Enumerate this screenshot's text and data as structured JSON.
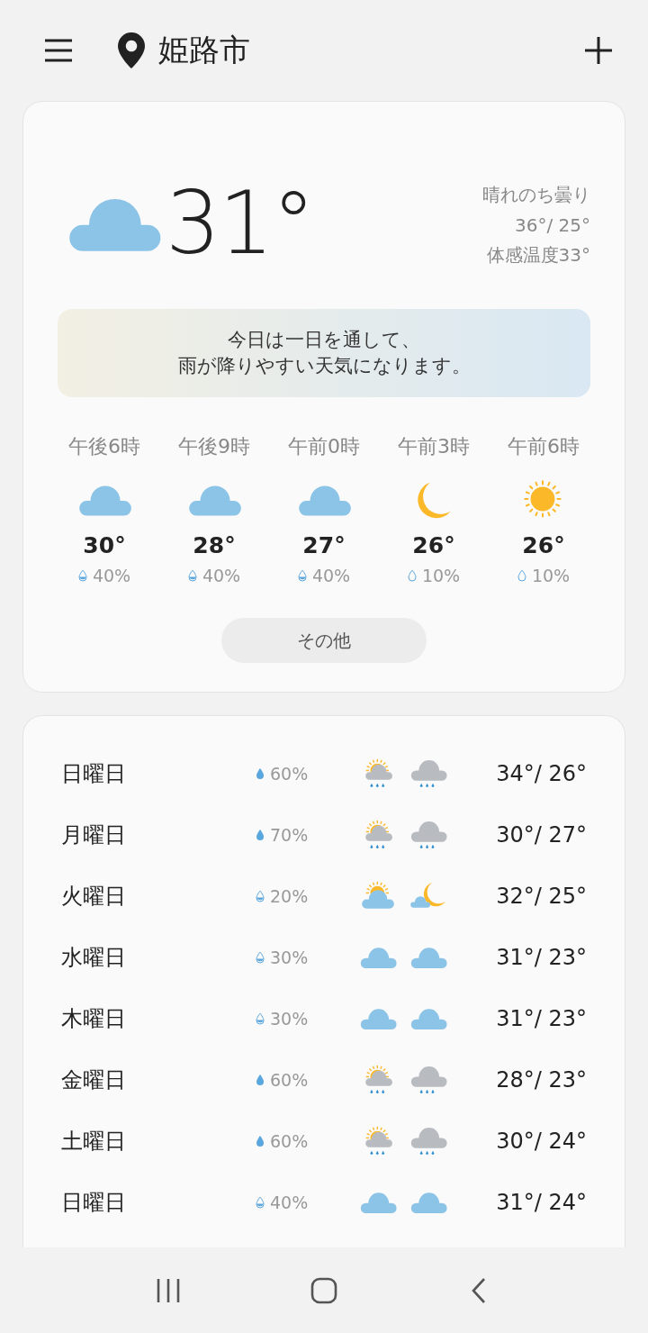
{
  "header": {
    "city": "姫路市"
  },
  "current": {
    "icon": {
      "kind": "cloud"
    },
    "temperature": "31°",
    "condition": "晴れのち曇り",
    "high_low": "36°/ 25°",
    "feels_like": "体感温度33°"
  },
  "summary": [
    "今日は一日を通して、",
    "雨が降りやすい天気になります。"
  ],
  "hourly": [
    {
      "time": "午後6時",
      "icon": {
        "kind": "cloud"
      },
      "temperature": "30°",
      "drop": {
        "kind": "half"
      },
      "precipitation": "40%"
    },
    {
      "time": "午後9時",
      "icon": {
        "kind": "cloud"
      },
      "temperature": "28°",
      "drop": {
        "kind": "half"
      },
      "precipitation": "40%"
    },
    {
      "time": "午前0時",
      "icon": {
        "kind": "cloud"
      },
      "temperature": "27°",
      "drop": {
        "kind": "half"
      },
      "precipitation": "40%"
    },
    {
      "time": "午前3時",
      "icon": {
        "kind": "moon"
      },
      "temperature": "26°",
      "drop": {
        "kind": "empty"
      },
      "precipitation": "10%"
    },
    {
      "time": "午前6時",
      "icon": {
        "kind": "sun"
      },
      "temperature": "26°",
      "drop": {
        "kind": "empty"
      },
      "precipitation": "10%"
    }
  ],
  "more_button": "その他",
  "daily": [
    {
      "day": "日曜日",
      "drop": {
        "kind": "full"
      },
      "precipitation": "60%",
      "day_icon": {
        "kind": "sun-rain"
      },
      "night_icon": {
        "kind": "rain"
      },
      "temperature": "34°/ 26°"
    },
    {
      "day": "月曜日",
      "drop": {
        "kind": "full"
      },
      "precipitation": "70%",
      "day_icon": {
        "kind": "sun-rain"
      },
      "night_icon": {
        "kind": "rain"
      },
      "temperature": "30°/ 27°"
    },
    {
      "day": "火曜日",
      "drop": {
        "kind": "half"
      },
      "precipitation": "20%",
      "day_icon": {
        "kind": "sun-cloud"
      },
      "night_icon": {
        "kind": "moon-cloud"
      },
      "temperature": "32°/ 25°"
    },
    {
      "day": "水曜日",
      "drop": {
        "kind": "half"
      },
      "precipitation": "30%",
      "day_icon": {
        "kind": "cloud"
      },
      "night_icon": {
        "kind": "cloud"
      },
      "temperature": "31°/ 23°"
    },
    {
      "day": "木曜日",
      "drop": {
        "kind": "half"
      },
      "precipitation": "30%",
      "day_icon": {
        "kind": "cloud"
      },
      "night_icon": {
        "kind": "cloud"
      },
      "temperature": "31°/ 23°"
    },
    {
      "day": "金曜日",
      "drop": {
        "kind": "full"
      },
      "precipitation": "60%",
      "day_icon": {
        "kind": "sun-rain"
      },
      "night_icon": {
        "kind": "rain"
      },
      "temperature": "28°/ 23°"
    },
    {
      "day": "土曜日",
      "drop": {
        "kind": "full"
      },
      "precipitation": "60%",
      "day_icon": {
        "kind": "sun-rain"
      },
      "night_icon": {
        "kind": "rain"
      },
      "temperature": "30°/ 24°"
    },
    {
      "day": "日曜日",
      "drop": {
        "kind": "half"
      },
      "precipitation": "40%",
      "day_icon": {
        "kind": "cloud"
      },
      "night_icon": {
        "kind": "cloud"
      },
      "temperature": "31°/ 24°"
    }
  ]
}
